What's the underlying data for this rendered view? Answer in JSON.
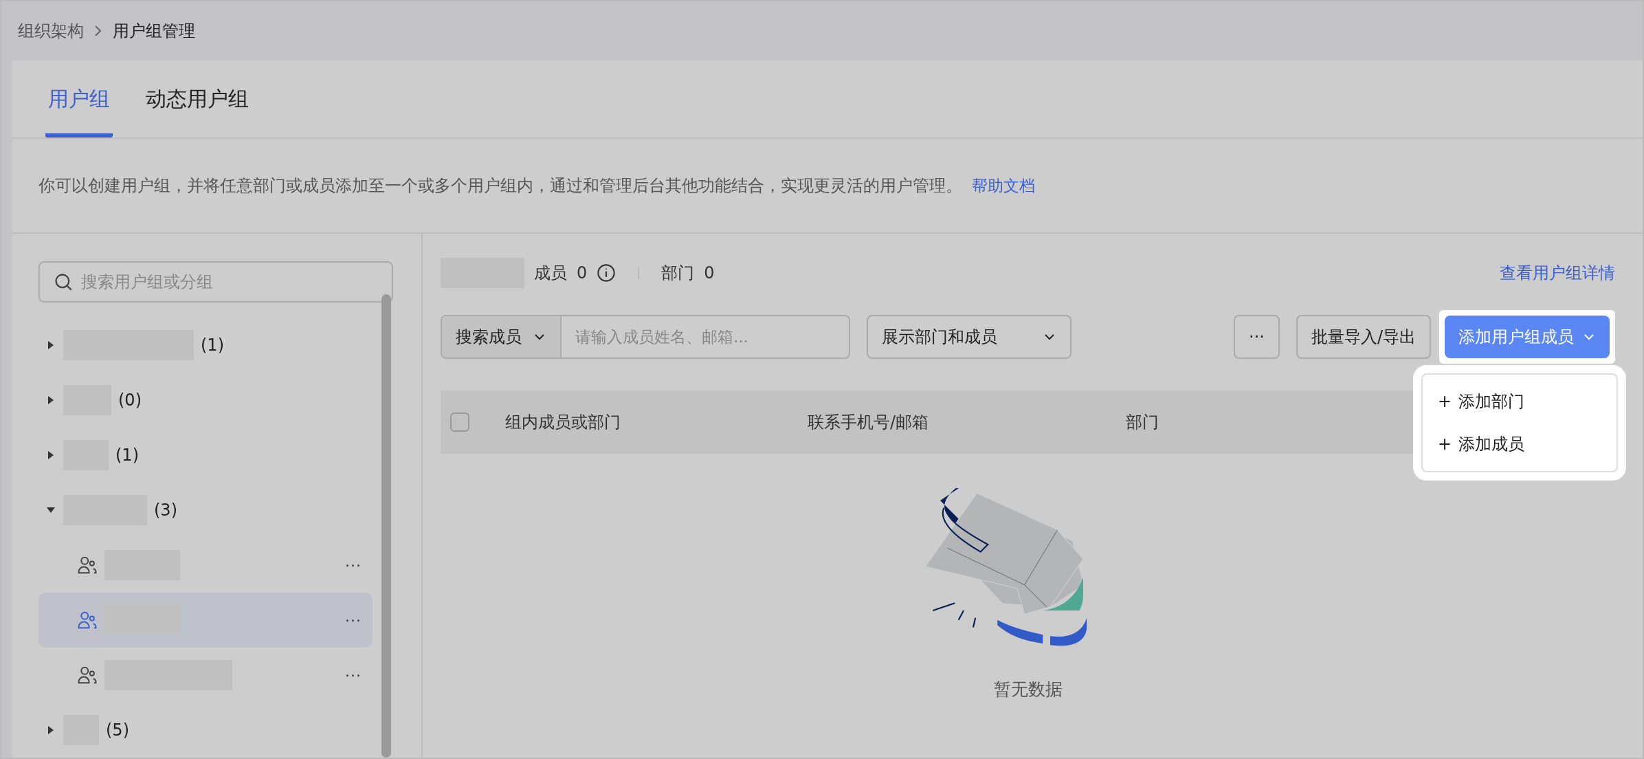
{
  "breadcrumb": [
    {
      "label": "组织架构",
      "current": false
    },
    {
      "label": "用户组管理",
      "current": true
    }
  ],
  "tabs": [
    {
      "label": "用户组",
      "selected": true
    },
    {
      "label": "动态用户组",
      "selected": false
    }
  ],
  "description": {
    "text": "你可以创建用户组，并将任意部门或成员添加至一个或多个用户组内，通过和管理后台其他功能结合，实现更灵活的用户管理。",
    "link": "帮助文档"
  },
  "sidebar": {
    "search": {
      "placeholder": "搜索用户组或分组"
    },
    "tree": [
      {
        "count": "(1)",
        "expanded": false,
        "selected": false
      },
      {
        "count": "(0)",
        "expanded": false,
        "selected": false
      },
      {
        "count": "(1)",
        "expanded": false,
        "selected": false
      },
      {
        "count": "(3)",
        "expanded": true,
        "selected": false,
        "children": [
          {
            "selected": false,
            "more": "···"
          },
          {
            "selected": true,
            "more": "···"
          },
          {
            "selected": false,
            "more": "···"
          }
        ]
      },
      {
        "count": "(5)",
        "expanded": false,
        "selected": false
      }
    ]
  },
  "summary": {
    "members_label": "成员",
    "members_count": "0",
    "departments_label": "部门",
    "departments_count": "0",
    "details_link": "查看用户组详情"
  },
  "toolbar": {
    "search_type": "搜索成员",
    "search_placeholder": "请输入成员姓名、邮箱...",
    "display_select": "展示部门和成员",
    "more": "···",
    "batch": "批量导入/导出",
    "add": "添加用户组成员"
  },
  "add_menu": {
    "open": true,
    "items": [
      {
        "icon": "+",
        "label": "添加部门"
      },
      {
        "icon": "+",
        "label": "添加成员"
      }
    ]
  },
  "table": {
    "select_all": {
      "checked": false
    },
    "columns": [
      "组内成员或部门",
      "联系手机号/邮箱",
      "部门"
    ],
    "empty_text": "暂无数据"
  }
}
